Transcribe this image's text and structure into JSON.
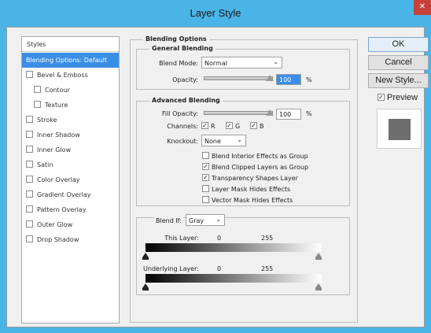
{
  "window": {
    "title": "Layer Style",
    "close_icon": "close-icon"
  },
  "styles_panel": {
    "header": "Styles",
    "items": [
      {
        "label": "Blending Options: Default",
        "active": true,
        "checkbox": false
      },
      {
        "label": "Bevel & Emboss",
        "checked": false
      },
      {
        "label": "Contour",
        "checked": false,
        "indent": true
      },
      {
        "label": "Texture",
        "checked": false,
        "indent": true
      },
      {
        "label": "Stroke",
        "checked": false
      },
      {
        "label": "Inner Shadow",
        "checked": false
      },
      {
        "label": "Inner Glow",
        "checked": false
      },
      {
        "label": "Satin",
        "checked": false
      },
      {
        "label": "Color Overlay",
        "checked": false
      },
      {
        "label": "Gradient Overlay",
        "checked": false
      },
      {
        "label": "Pattern Overlay",
        "checked": false
      },
      {
        "label": "Outer Glow",
        "checked": false
      },
      {
        "label": "Drop Shadow",
        "checked": false
      }
    ]
  },
  "blending_options": {
    "title": "Blending Options",
    "general": {
      "title": "General Blending",
      "blend_mode_label": "Blend Mode:",
      "blend_mode_value": "Normal",
      "opacity_label": "Opacity:",
      "opacity_value": "100",
      "opacity_unit": "%",
      "opacity_level": 1.0
    },
    "advanced": {
      "title": "Advanced Blending",
      "fill_opacity_label": "Fill Opacity:",
      "fill_opacity_value": "100",
      "fill_opacity_unit": "%",
      "fill_opacity_level": 1.0,
      "channels_label": "Channels:",
      "channels": [
        {
          "label": "R",
          "checked": true
        },
        {
          "label": "G",
          "checked": true
        },
        {
          "label": "B",
          "checked": true
        }
      ],
      "knockout_label": "Knockout:",
      "knockout_value": "None",
      "options": [
        {
          "label": "Blend Interior Effects as Group",
          "checked": false
        },
        {
          "label": "Blend Clipped Layers as Group",
          "checked": true
        },
        {
          "label": "Transparency Shapes Layer",
          "checked": true
        },
        {
          "label": "Layer Mask Hides Effects",
          "checked": false
        },
        {
          "label": "Vector Mask Hides Effects",
          "checked": false
        }
      ]
    },
    "blend_if": {
      "label": "Blend If:",
      "value": "Gray",
      "this_layer_label": "This Layer:",
      "this_layer_min": "0",
      "this_layer_max": "255",
      "underlying_label": "Underlying Layer:",
      "underlying_min": "0",
      "underlying_max": "255"
    }
  },
  "buttons": {
    "ok": "OK",
    "cancel": "Cancel",
    "new_style": "New Style...",
    "preview_label": "Preview",
    "preview_checked": true
  },
  "check_mark": "✓",
  "chevron": "⌄"
}
